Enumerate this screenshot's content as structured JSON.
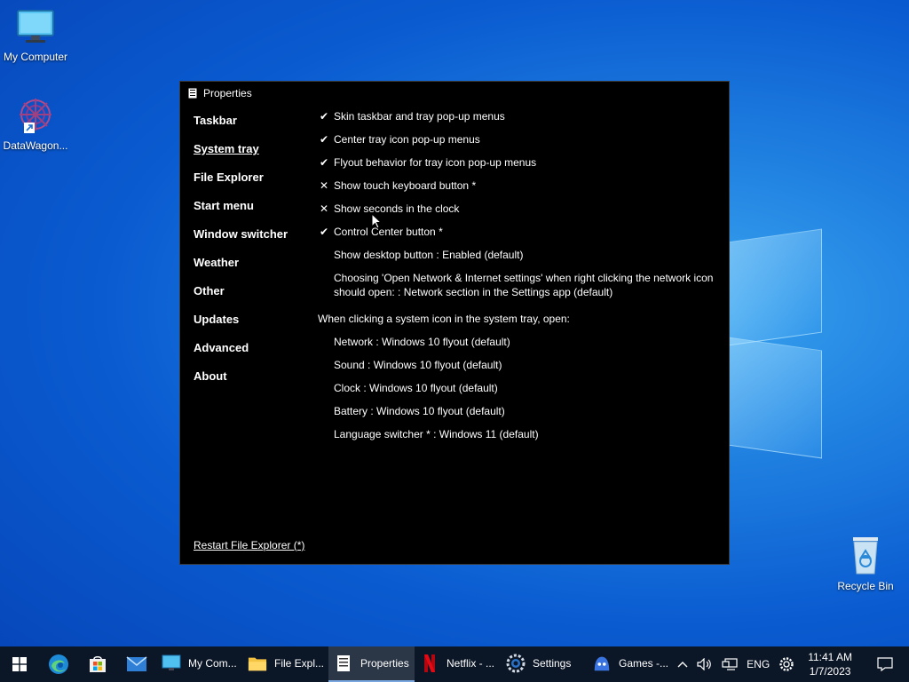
{
  "desktop": {
    "icons": [
      {
        "label": "My Computer"
      },
      {
        "label": "DataWagon..."
      },
      {
        "label": "Recycle Bin"
      }
    ]
  },
  "window": {
    "title": "Properties",
    "nav": [
      {
        "label": "Taskbar",
        "active": false
      },
      {
        "label": "System tray",
        "active": true
      },
      {
        "label": "File Explorer",
        "active": false
      },
      {
        "label": "Start menu",
        "active": false
      },
      {
        "label": "Window switcher",
        "active": false
      },
      {
        "label": "Weather",
        "active": false
      },
      {
        "label": "Other",
        "active": false
      },
      {
        "label": "Updates",
        "active": false
      },
      {
        "label": "Advanced",
        "active": false
      },
      {
        "label": "About",
        "active": false
      }
    ],
    "settings": [
      {
        "mark": "✔",
        "text": "Skin taskbar and tray pop-up menus"
      },
      {
        "mark": "✔",
        "text": "Center tray icon pop-up menus"
      },
      {
        "mark": "✔",
        "text": "Flyout behavior for tray icon pop-up menus"
      },
      {
        "mark": "✕",
        "text": "Show touch keyboard button *"
      },
      {
        "mark": "✕",
        "text": "Show seconds in the clock"
      },
      {
        "mark": "✔",
        "text": "Control Center button *"
      },
      {
        "mark": "",
        "text": "Show desktop button : Enabled (default)"
      },
      {
        "mark": "",
        "text": "Choosing 'Open Network & Internet settings' when right clicking the network icon should open: : Network section in the Settings app (default)"
      }
    ],
    "section_heading": "When clicking a system icon in the system tray, open:",
    "system_icons": [
      {
        "text": "Network : Windows 10 flyout (default)"
      },
      {
        "text": "Sound : Windows 10 flyout (default)"
      },
      {
        "text": "Clock : Windows 10 flyout (default)"
      },
      {
        "text": "Battery : Windows 10 flyout (default)"
      },
      {
        "text": "Language switcher * : Windows 11 (default)"
      }
    ],
    "restart_link": "Restart File Explorer (*)"
  },
  "taskbar": {
    "apps": [
      {
        "label": "My Com...",
        "icon": "monitor-icon",
        "active": false
      },
      {
        "label": "File Expl...",
        "icon": "folder-icon",
        "active": false
      },
      {
        "label": "Properties",
        "icon": "properties-icon",
        "active": true
      },
      {
        "label": "Netflix - ...",
        "icon": "netflix-icon",
        "active": false
      },
      {
        "label": "Settings",
        "icon": "settings-icon",
        "active": false
      },
      {
        "label": "Games -...",
        "icon": "games-icon",
        "active": false
      }
    ],
    "language": "ENG",
    "time": "11:41 AM",
    "date": "1/7/2023"
  },
  "colors": {
    "taskbar_bg": "#0b1626",
    "window_bg": "#000000",
    "active_indicator": "#7aa7e0"
  }
}
